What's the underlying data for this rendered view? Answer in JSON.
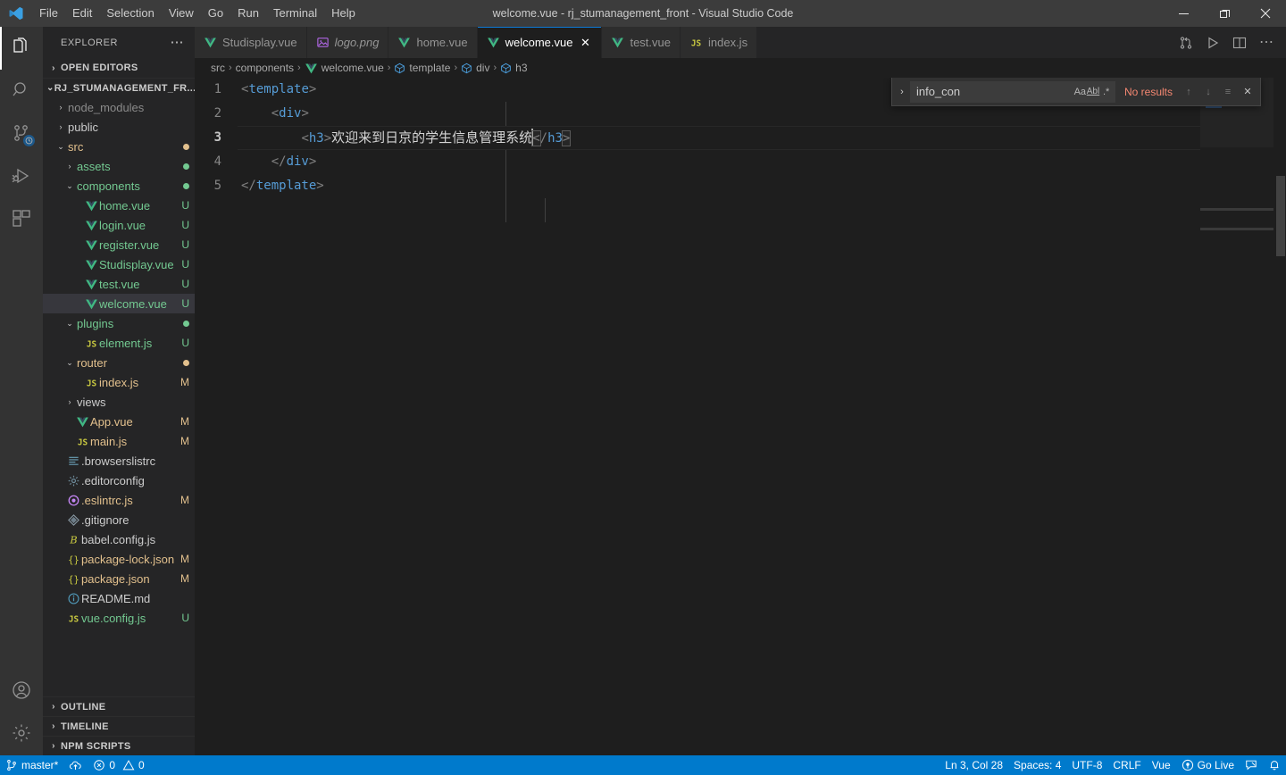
{
  "window": {
    "title": "welcome.vue - rj_stumanagement_front - Visual Studio Code",
    "minimize": "─",
    "maximize": "❐",
    "close": "✕"
  },
  "menu": {
    "items": [
      {
        "label": "File"
      },
      {
        "label": "Edit"
      },
      {
        "label": "Selection"
      },
      {
        "label": "View"
      },
      {
        "label": "Go"
      },
      {
        "label": "Run"
      },
      {
        "label": "Terminal"
      },
      {
        "label": "Help"
      }
    ]
  },
  "activitybar": {
    "items": [
      {
        "name": "explorer-icon",
        "active": true
      },
      {
        "name": "search-icon",
        "active": false
      },
      {
        "name": "source-control-icon",
        "active": false
      },
      {
        "name": "run-and-debug-icon",
        "active": false
      },
      {
        "name": "extensions-icon",
        "active": false
      }
    ],
    "bottom": [
      {
        "name": "accounts-icon"
      },
      {
        "name": "settings-gear-icon"
      }
    ]
  },
  "sidebar": {
    "title": "EXPLORER",
    "more_actions": "⋯",
    "open_editors": {
      "label": "OPEN EDITORS",
      "twisty": "›"
    },
    "project": {
      "label": "RJ_STUMANAGEMENT_FR...",
      "twisty": "⌄"
    },
    "tree": [
      {
        "label": "node_modules",
        "kind": "folder",
        "indent": 1,
        "twisty": "›",
        "color": "dim",
        "deco": "",
        "decoClass": ""
      },
      {
        "label": "public",
        "kind": "folder",
        "indent": 1,
        "twisty": "›",
        "color": "plain",
        "deco": "",
        "decoClass": ""
      },
      {
        "label": "src",
        "kind": "folder",
        "indent": 1,
        "twisty": "⌄",
        "color": "m",
        "deco": "dot-m",
        "decoClass": "g-m"
      },
      {
        "label": "assets",
        "kind": "folder",
        "indent": 2,
        "twisty": "›",
        "color": "u",
        "deco": "dot-u",
        "decoClass": "g-u"
      },
      {
        "label": "components",
        "kind": "folder",
        "indent": 2,
        "twisty": "⌄",
        "color": "u",
        "deco": "dot-u",
        "decoClass": "g-u"
      },
      {
        "label": "home.vue",
        "kind": "vue",
        "indent": 3,
        "twisty": "",
        "color": "u",
        "deco": "U",
        "decoClass": "g-u"
      },
      {
        "label": "login.vue",
        "kind": "vue",
        "indent": 3,
        "twisty": "",
        "color": "u",
        "deco": "U",
        "decoClass": "g-u"
      },
      {
        "label": "register.vue",
        "kind": "vue",
        "indent": 3,
        "twisty": "",
        "color": "u",
        "deco": "U",
        "decoClass": "g-u"
      },
      {
        "label": "Studisplay.vue",
        "kind": "vue",
        "indent": 3,
        "twisty": "",
        "color": "u",
        "deco": "U",
        "decoClass": "g-u"
      },
      {
        "label": "test.vue",
        "kind": "vue",
        "indent": 3,
        "twisty": "",
        "color": "u",
        "deco": "U",
        "decoClass": "g-u"
      },
      {
        "label": "welcome.vue",
        "kind": "vue",
        "indent": 3,
        "twisty": "",
        "color": "u",
        "deco": "U",
        "decoClass": "g-u",
        "selected": true
      },
      {
        "label": "plugins",
        "kind": "folder",
        "indent": 2,
        "twisty": "⌄",
        "color": "u",
        "deco": "dot-u",
        "decoClass": "g-u"
      },
      {
        "label": "element.js",
        "kind": "js",
        "indent": 3,
        "twisty": "",
        "color": "u",
        "deco": "U",
        "decoClass": "g-u"
      },
      {
        "label": "router",
        "kind": "folder",
        "indent": 2,
        "twisty": "⌄",
        "color": "m",
        "deco": "dot-m",
        "decoClass": "g-m"
      },
      {
        "label": "index.js",
        "kind": "js",
        "indent": 3,
        "twisty": "",
        "color": "m",
        "deco": "M",
        "decoClass": "g-m"
      },
      {
        "label": "views",
        "kind": "folder",
        "indent": 2,
        "twisty": "›",
        "color": "plain",
        "deco": "",
        "decoClass": ""
      },
      {
        "label": "App.vue",
        "kind": "vue",
        "indent": 2,
        "twisty": "",
        "color": "m",
        "deco": "M",
        "decoClass": "g-m"
      },
      {
        "label": "main.js",
        "kind": "js",
        "indent": 2,
        "twisty": "",
        "color": "m",
        "deco": "M",
        "decoClass": "g-m"
      },
      {
        "label": ".browserslistrc",
        "kind": "list",
        "indent": 1,
        "twisty": "",
        "color": "plain",
        "deco": "",
        "decoClass": ""
      },
      {
        "label": ".editorconfig",
        "kind": "gear",
        "indent": 1,
        "twisty": "",
        "color": "plain",
        "deco": "",
        "decoClass": ""
      },
      {
        "label": ".eslintrc.js",
        "kind": "eslint",
        "indent": 1,
        "twisty": "",
        "color": "m",
        "deco": "M",
        "decoClass": "g-m"
      },
      {
        "label": ".gitignore",
        "kind": "git",
        "indent": 1,
        "twisty": "",
        "color": "plain",
        "deco": "",
        "decoClass": ""
      },
      {
        "label": "babel.config.js",
        "kind": "babel",
        "indent": 1,
        "twisty": "",
        "color": "plain",
        "deco": "",
        "decoClass": ""
      },
      {
        "label": "package-lock.json",
        "kind": "json",
        "indent": 1,
        "twisty": "",
        "color": "m",
        "deco": "M",
        "decoClass": "g-m"
      },
      {
        "label": "package.json",
        "kind": "json",
        "indent": 1,
        "twisty": "",
        "color": "m",
        "deco": "M",
        "decoClass": "g-m"
      },
      {
        "label": "README.md",
        "kind": "readme",
        "indent": 1,
        "twisty": "",
        "color": "plain",
        "deco": "",
        "decoClass": ""
      },
      {
        "label": "vue.config.js",
        "kind": "js",
        "indent": 1,
        "twisty": "",
        "color": "u",
        "deco": "U",
        "decoClass": "g-u"
      }
    ],
    "bottom_sections": [
      {
        "label": "OUTLINE",
        "twisty": "›"
      },
      {
        "label": "TIMELINE",
        "twisty": "›"
      },
      {
        "label": "NPM SCRIPTS",
        "twisty": "›"
      }
    ]
  },
  "tabs": [
    {
      "label": "Studisplay.vue",
      "icon": "vue-icon",
      "active": false,
      "italic": false
    },
    {
      "label": "logo.png",
      "icon": "image-icon",
      "active": false,
      "italic": true
    },
    {
      "label": "home.vue",
      "icon": "vue-icon",
      "active": false,
      "italic": false
    },
    {
      "label": "welcome.vue",
      "icon": "vue-icon",
      "active": true,
      "italic": false,
      "close": "✕"
    },
    {
      "label": "test.vue",
      "icon": "vue-icon",
      "active": false,
      "italic": false
    },
    {
      "label": "index.js",
      "icon": "js-icon",
      "active": false,
      "italic": false
    }
  ],
  "editor_actions": [
    {
      "name": "open-changes-icon"
    },
    {
      "name": "run-play-icon"
    },
    {
      "name": "split-editor-icon"
    },
    {
      "name": "more-actions-icon",
      "glyph": "⋯"
    }
  ],
  "breadcrumbs": [
    {
      "label": "src",
      "icon": ""
    },
    {
      "label": "components",
      "icon": ""
    },
    {
      "label": "welcome.vue",
      "icon": "vue-icon"
    },
    {
      "label": "template",
      "icon": "symbol-icon"
    },
    {
      "label": "div",
      "icon": "symbol-icon"
    },
    {
      "label": "h3",
      "icon": "symbol-icon"
    }
  ],
  "breadcrumb_separator": "›",
  "editor": {
    "lines": [
      {
        "num": "1",
        "current": false
      },
      {
        "num": "2",
        "current": false
      },
      {
        "num": "3",
        "current": true
      },
      {
        "num": "4",
        "current": false
      },
      {
        "num": "5",
        "current": false
      }
    ],
    "line1_open": "<",
    "line1_tag": "template",
    "line1_close": ">",
    "line2_open": "<",
    "line2_tag": "div",
    "line2_close": ">",
    "line3_open": "<",
    "line3_tag": "h3",
    "line3_gt": ">",
    "line3_text": "欢迎来到日京的学生信息管理系统",
    "line3_close_lt": "<",
    "line3_close_slash": "/",
    "line3_close_tag": "h3",
    "line3_close_gt": ">",
    "line4_open": "</",
    "line4_tag": "div",
    "line4_close": ">",
    "line5_open": "</",
    "line5_tag": "template",
    "line5_close": ">"
  },
  "find_widget": {
    "toggle_replace": "›",
    "value": "info_con",
    "placeholder": "Find",
    "match_case": "Aa",
    "whole_word": "Abl",
    "regex": ".*",
    "result_text": "No results",
    "prev": "↑",
    "next": "↓",
    "find_in_selection": "≡",
    "close": "✕"
  },
  "statusbar": {
    "left": [
      {
        "name": "remote-branch",
        "icon": "git-branch-icon",
        "label": "master*"
      },
      {
        "name": "sync-changes",
        "icon": "sync-cloud-icon",
        "label": ""
      },
      {
        "name": "problems",
        "icon": "error-warning-icons",
        "label": "0",
        "label2": "0"
      }
    ],
    "right": [
      {
        "name": "editor-position",
        "label": "Ln 3, Col 28"
      },
      {
        "name": "editor-indentation",
        "label": "Spaces: 4"
      },
      {
        "name": "editor-encoding",
        "label": "UTF-8"
      },
      {
        "name": "editor-eol",
        "label": "CRLF"
      },
      {
        "name": "editor-language",
        "label": "Vue"
      },
      {
        "name": "go-live",
        "icon": "broadcast-icon",
        "label": "Go Live"
      },
      {
        "name": "feedback",
        "icon": "feedback-icon",
        "label": ""
      },
      {
        "name": "notifications",
        "icon": "bell-icon",
        "label": ""
      }
    ]
  },
  "colors": {
    "accent": "#007acc",
    "tab_active_border": "#0d7ad6",
    "git_untracked": "#73c991",
    "git_modified": "#e2c08d",
    "error_text": "#f48771",
    "tag_blue": "#569cd6"
  }
}
